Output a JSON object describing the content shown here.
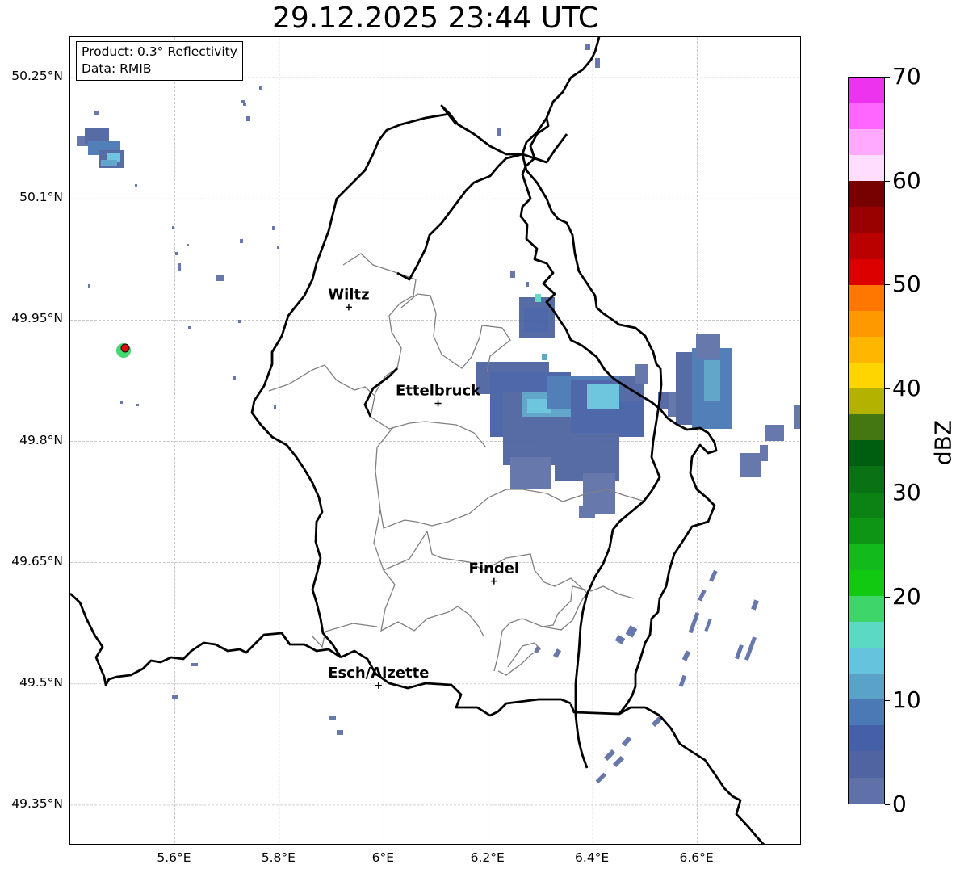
{
  "title": "29.12.2025 23:44 UTC",
  "info": {
    "product": "Product: 0.3° Reflectivity",
    "data": "Data: RMIB"
  },
  "lat_labels": [
    "50.25°N",
    "50.1°N",
    "49.95°N",
    "49.8°N",
    "49.65°N",
    "49.5°N",
    "49.35°N"
  ],
  "lat_values": [
    50.25,
    50.1,
    49.95,
    49.8,
    49.65,
    49.5,
    49.35
  ],
  "lon_labels": [
    "5.6°E",
    "5.8°E",
    "6°E",
    "6.2°E",
    "6.4°E",
    "6.6°E"
  ],
  "lon_values": [
    5.6,
    5.8,
    6.0,
    6.2,
    6.4,
    6.6
  ],
  "cities": [
    {
      "name": "Wiltz",
      "lon": 5.933,
      "lat": 49.966
    },
    {
      "name": "Ettelbruck",
      "lon": 6.104,
      "lat": 49.847
    },
    {
      "name": "Findel",
      "lon": 6.211,
      "lat": 49.627
    },
    {
      "name": "Esch/Alzette",
      "lon": 5.99,
      "lat": 49.498
    }
  ],
  "colorbar": {
    "unit": "dBZ",
    "tick_labels": [
      "70",
      "60",
      "50",
      "40",
      "30",
      "20",
      "10",
      "0"
    ],
    "tick_values": [
      70,
      60,
      50,
      40,
      30,
      20,
      10,
      0
    ],
    "min": 0,
    "max": 70,
    "colors": [
      "#ee33ee",
      "#ff66ff",
      "#ffaaff",
      "#ffddff",
      "#770000",
      "#990000",
      "#bb0000",
      "#dd0000",
      "#ff7700",
      "#ff9900",
      "#ffb600",
      "#ffd500",
      "#b3b200",
      "#447711",
      "#005e10",
      "#0a7114",
      "#0d8214",
      "#0f9516",
      "#12ba1b",
      "#11c911",
      "#3ed66a",
      "#5cd9c2",
      "#66c3dd",
      "#5aa2c8",
      "#4a79b5",
      "#4560a6",
      "#4f64a0",
      "#5f71a8"
    ]
  },
  "map_extent": {
    "lon_min": 5.4,
    "lon_max": 6.8,
    "lat_min": 49.3,
    "lat_max": 50.3
  }
}
